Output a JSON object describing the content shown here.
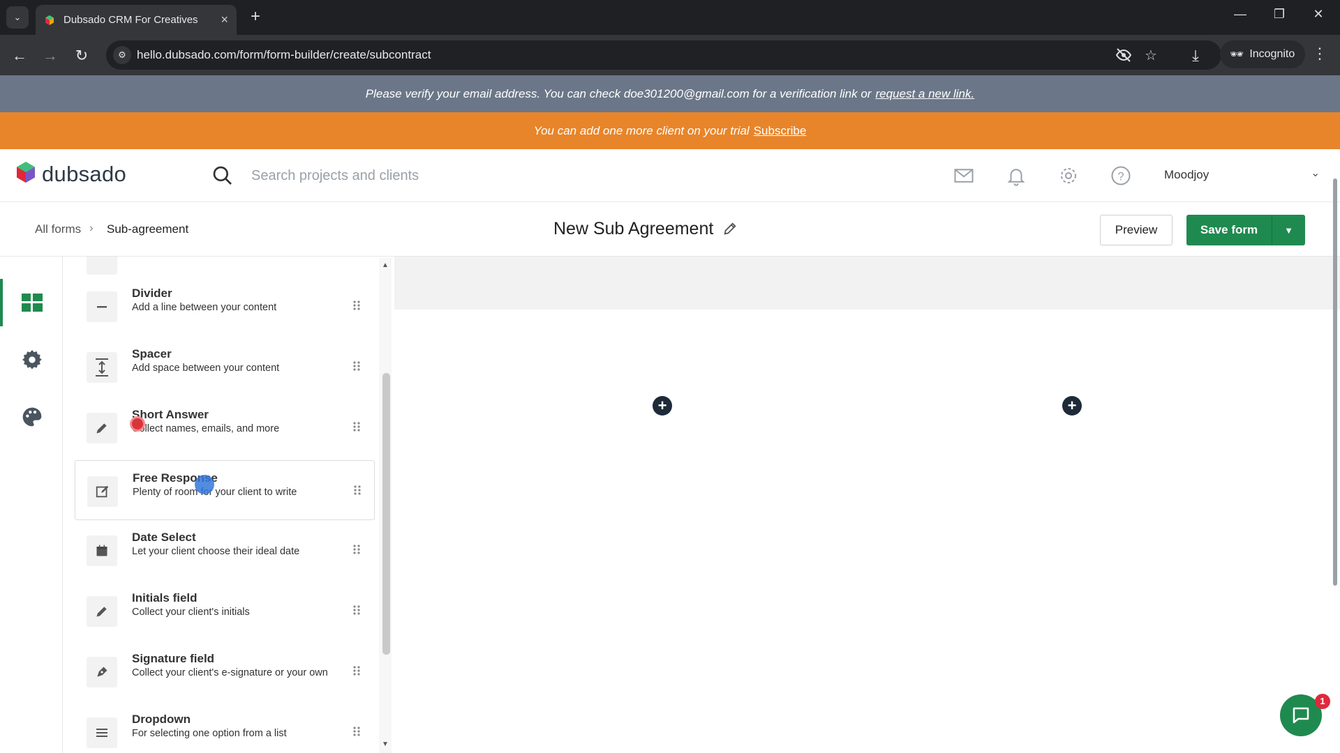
{
  "browser": {
    "tab_title": "Dubsado CRM For Creatives",
    "url": "hello.dubsado.com/form/form-builder/create/subcontract",
    "incognito_label": "Incognito"
  },
  "banners": {
    "verify_text": "Please verify your email address. You can check doe301200@gmail.com for a verification link or",
    "verify_link": "request a new link.",
    "trial_text": "You can add one more client on your trial",
    "trial_link": "Subscribe"
  },
  "header": {
    "brand": "dubsado",
    "search_placeholder": "Search projects and clients",
    "user_name": "Moodjoy"
  },
  "breadcrumb": {
    "all": "All forms",
    "separator": "›",
    "current": "Sub-agreement"
  },
  "form": {
    "title": "New Sub Agreement",
    "preview_label": "Preview",
    "save_label": "Save form"
  },
  "elements": [
    {
      "name": "Divider",
      "desc": "Add a line between your content",
      "icon": "minus-icon"
    },
    {
      "name": "Spacer",
      "desc": "Add space between your content",
      "icon": "vertical-spacing-icon"
    },
    {
      "name": "Short Answer",
      "desc": "Collect names, emails, and more",
      "icon": "pencil-icon"
    },
    {
      "name": "Free Response",
      "desc": "Plenty of room for your client to write",
      "icon": "edit-square-icon"
    },
    {
      "name": "Date Select",
      "desc": "Let your client choose their ideal date",
      "icon": "calendar-icon"
    },
    {
      "name": "Initials field",
      "desc": "Collect your client's initials",
      "icon": "pencil-icon"
    },
    {
      "name": "Signature field",
      "desc": "Collect your client's e-signature or your own",
      "icon": "pen-nib-icon"
    },
    {
      "name": "Dropdown",
      "desc": "For selecting one option from a list",
      "icon": "list-icon"
    }
  ],
  "chat_badge": "1",
  "colors": {
    "brand_green": "#1f8a4f",
    "verify_banner": "#6b7788",
    "trial_banner": "#e8852a"
  }
}
